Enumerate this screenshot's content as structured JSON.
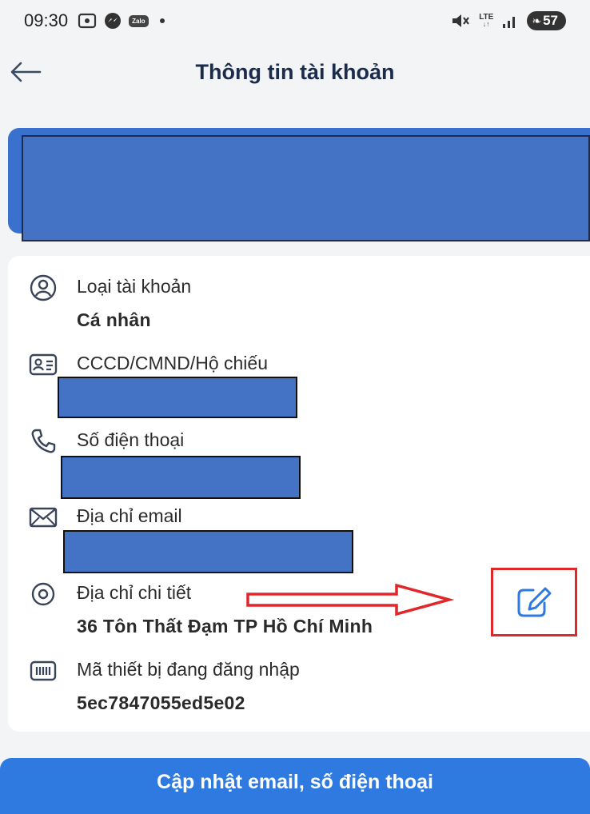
{
  "status_bar": {
    "time": "09:30",
    "left_icons": [
      "screenshot-icon",
      "messenger-icon",
      "zalo-icon"
    ],
    "zalo_label": "Zalo",
    "network_label": "LTE",
    "battery_level": "57"
  },
  "header": {
    "title": "Thông tin tài khoản"
  },
  "account_info": {
    "rows": [
      {
        "icon": "user-circle-icon",
        "label": "Loại tài khoản",
        "value": "Cá nhân"
      },
      {
        "icon": "id-card-icon",
        "label": "CCCD/CMND/Hộ chiếu",
        "value": ""
      },
      {
        "icon": "phone-icon",
        "label": "Số điện thoại",
        "value": ""
      },
      {
        "icon": "envelope-icon",
        "label": "Địa chỉ email",
        "value": ""
      },
      {
        "icon": "location-pin-icon",
        "label": "Địa chỉ chi tiết",
        "value": "36 Tôn Thất Đạm TP Hồ Chí Minh"
      },
      {
        "icon": "device-barcode-icon",
        "label": "Mã thiết bị đang đăng nhập",
        "value": "5ec7847055ed5e02"
      }
    ]
  },
  "actions": {
    "update_button_label": "Cập nhật email, số điện thoại"
  },
  "colors": {
    "primary": "#2f7ae0",
    "title": "#1a2b4c",
    "annotation": "#e0282b",
    "redaction": "#4472c4"
  }
}
